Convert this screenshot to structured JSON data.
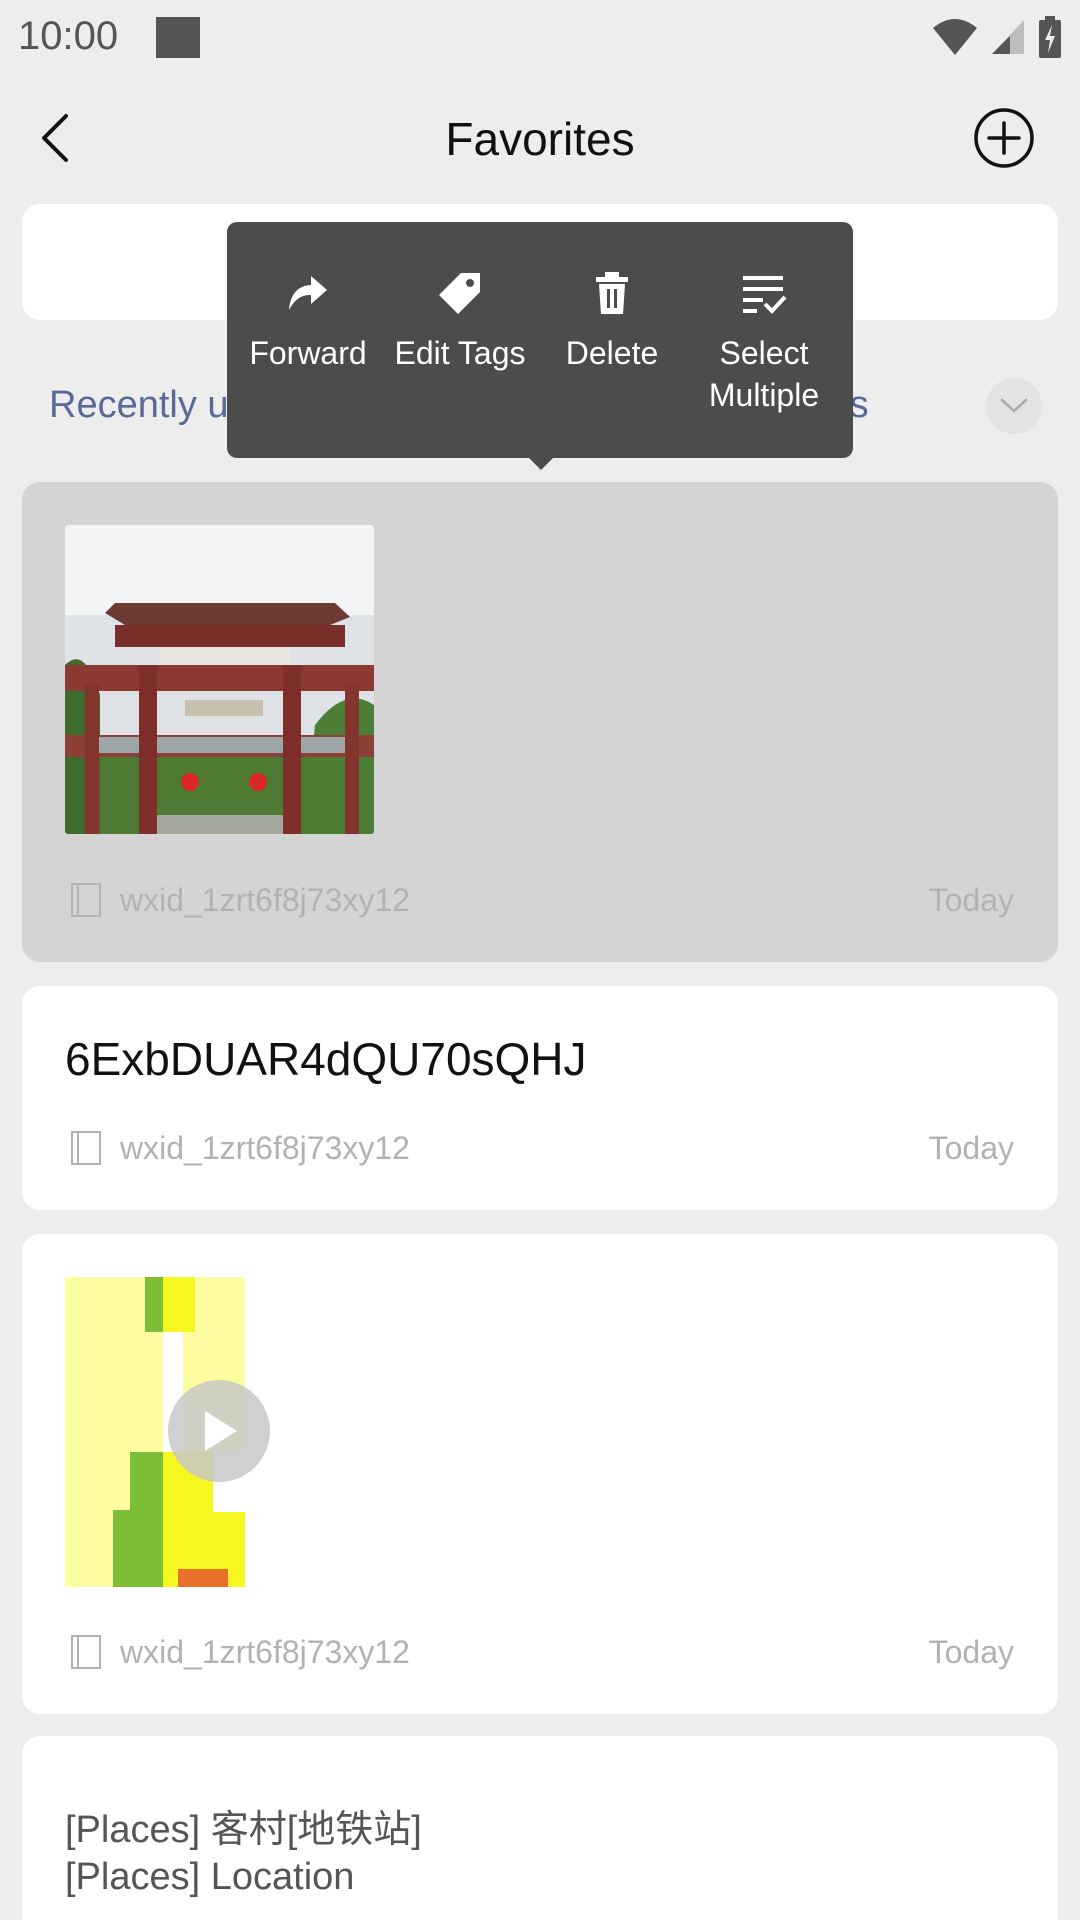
{
  "status_bar": {
    "time": "10:00"
  },
  "header": {
    "title": "Favorites"
  },
  "tags": {
    "left_partial": "Recently us",
    "right_partial": "els"
  },
  "context_menu": {
    "items": [
      {
        "label": "Forward",
        "icon": "forward-icon"
      },
      {
        "label": "Edit Tags",
        "icon": "tag-icon"
      },
      {
        "label": "Delete",
        "icon": "trash-icon"
      },
      {
        "label": "Select\nMultiple",
        "icon": "select-multiple-icon"
      }
    ]
  },
  "cards": [
    {
      "type": "image",
      "source": "wxid_1zrt6f8j73xy12",
      "date": "Today"
    },
    {
      "type": "text",
      "text": "6ExbDUAR4dQU70sQHJ",
      "source": "wxid_1zrt6f8j73xy12",
      "date": "Today"
    },
    {
      "type": "video",
      "source": "wxid_1zrt6f8j73xy12",
      "date": "Today"
    },
    {
      "type": "places",
      "lines": [
        "[Places] 客村[地铁站]",
        "[Places] Location"
      ]
    }
  ],
  "colors": {
    "background": "#ededed",
    "menu": "#4c4c4c",
    "link": "#576b95",
    "selected_card": "#d4d4d4"
  }
}
